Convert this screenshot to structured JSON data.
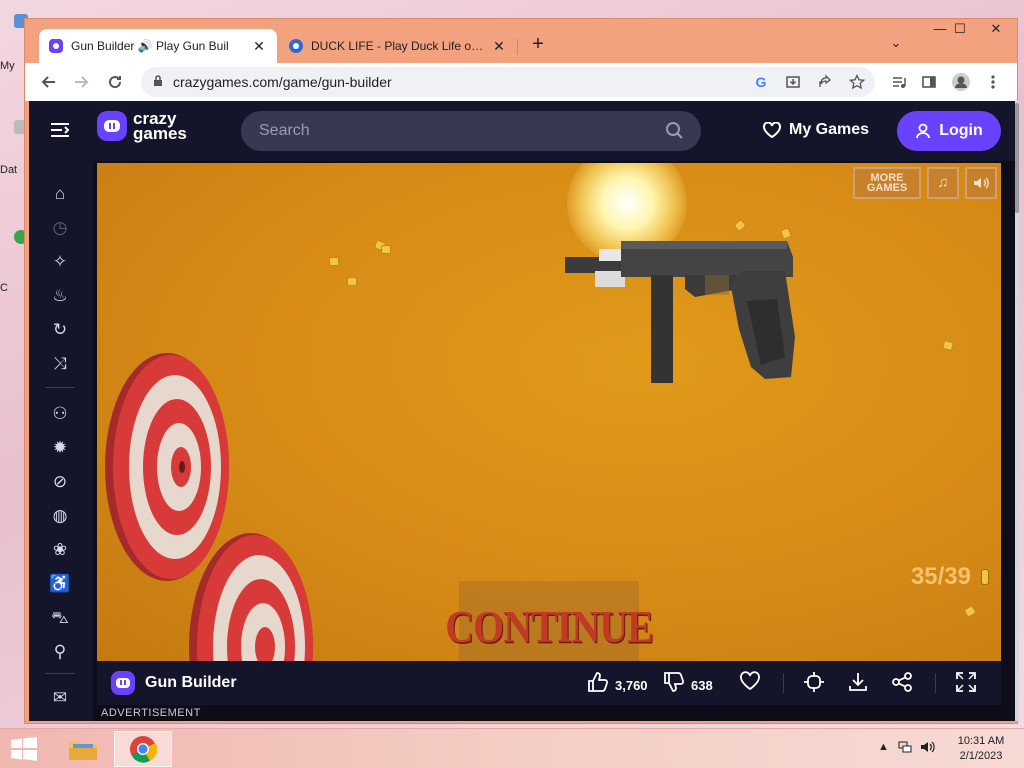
{
  "desktop": {
    "fragments": [
      "My",
      "Dat",
      "C"
    ]
  },
  "browser": {
    "tabs": [
      {
        "title": "Gun Builder 🔊 Play Gun Buil",
        "close": "✕",
        "active": true
      },
      {
        "title": "DUCK LIFE - Play Duck Life on Po",
        "close": "✕",
        "active": false
      }
    ],
    "new_tab": "+",
    "window_controls": {
      "minimize": "—",
      "maximize": "☐",
      "close": "✕",
      "dropdown": "⌄"
    },
    "url": "crazygames.com/game/gun-builder"
  },
  "site": {
    "logo_line1": "crazy",
    "logo_line2": "games",
    "search_placeholder": "Search",
    "my_games": "My Games",
    "login": "Login",
    "game": {
      "more_games_line1": "MORE",
      "more_games_line2": "GAMES",
      "ammo": "35/39",
      "continue": "CONTINUE"
    },
    "bottom": {
      "title": "Gun Builder",
      "likes": "3,760",
      "dislikes": "638"
    },
    "advertisement": "ADVERTISEMENT"
  },
  "taskbar": {
    "time": "10:31 AM",
    "date": "2/1/2023"
  },
  "colors": {
    "brand_purple": "#6842ff",
    "nav_dark": "#14152a",
    "window_frame": "#f3a27f",
    "game_orange": "#d68a16",
    "target_red": "#d83a3a",
    "continue_red": "#c23a26"
  }
}
